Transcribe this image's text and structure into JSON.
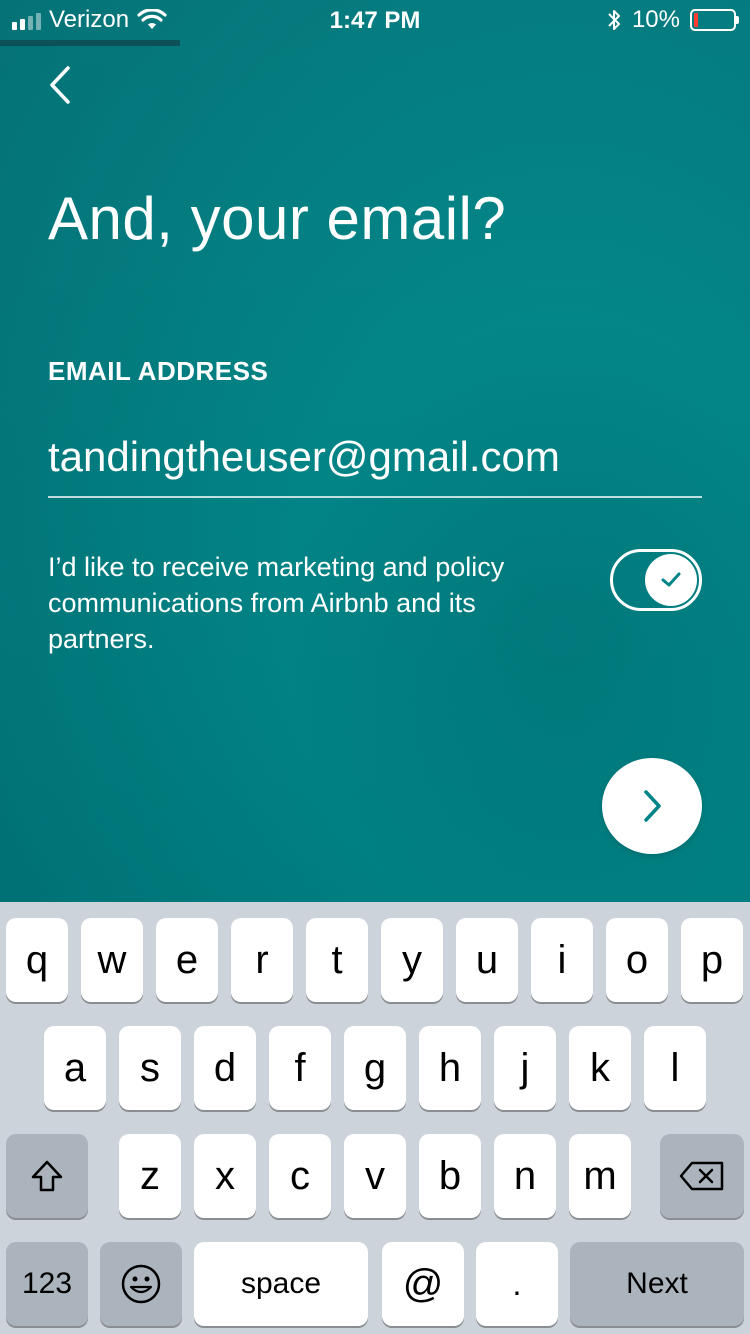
{
  "status_bar": {
    "carrier": "Verizon",
    "time": "1:47 PM",
    "battery": "10%"
  },
  "screen": {
    "title": "And, your email?",
    "email_label": "EMAIL ADDRESS",
    "email_value": "tandingtheuser@gmail.com",
    "consent_text": "I’d like to receive marketing and policy communications from Airbnb and its partners.",
    "consent_toggle_on": true,
    "progress_fraction": 0.24
  },
  "keyboard": {
    "row1": [
      "q",
      "w",
      "e",
      "r",
      "t",
      "y",
      "u",
      "i",
      "o",
      "p"
    ],
    "row2": [
      "a",
      "s",
      "d",
      "f",
      "g",
      "h",
      "j",
      "k",
      "l"
    ],
    "row3": [
      "z",
      "x",
      "c",
      "v",
      "b",
      "n",
      "m"
    ],
    "numbers_label": "123",
    "space_label": "space",
    "at_label": "@",
    "dot_label": ".",
    "return_label": "Next"
  },
  "colors": {
    "accent": "#008489",
    "battery_low": "#ff3b30"
  }
}
